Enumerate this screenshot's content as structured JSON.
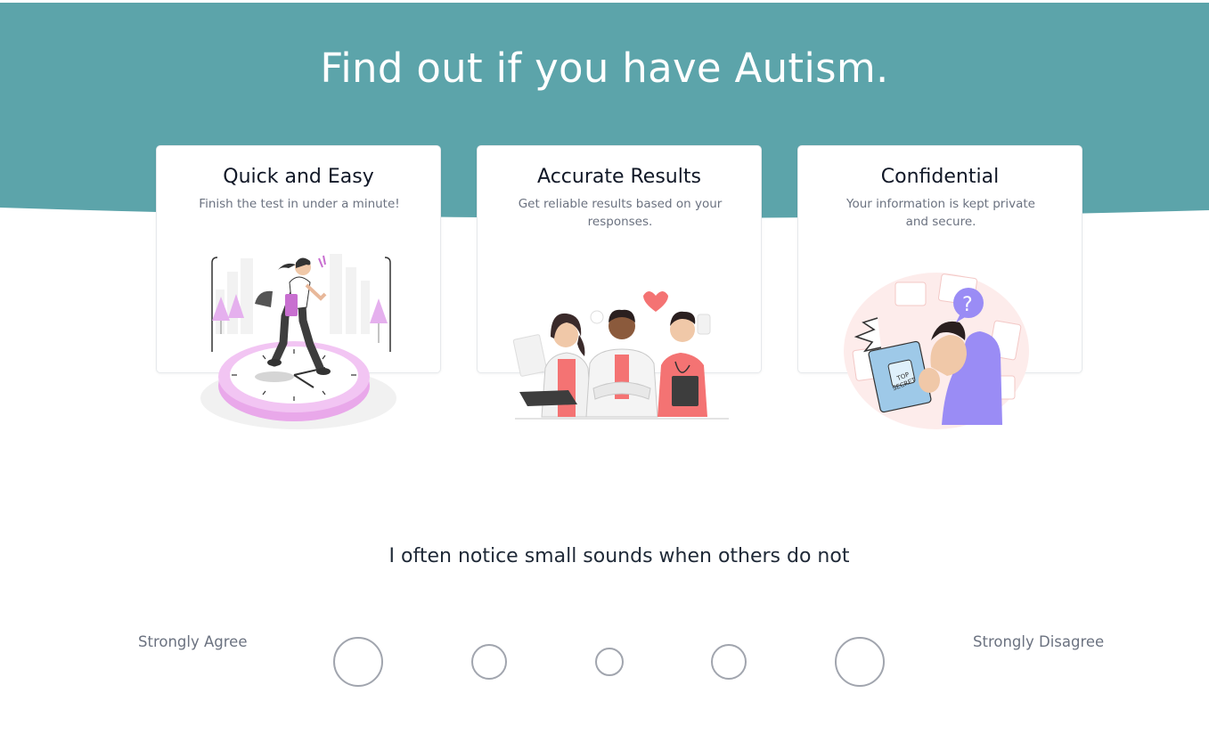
{
  "hero": {
    "title": "Find out if you have Autism.",
    "background_color": "#5ca4aa"
  },
  "features": [
    {
      "title": "Quick and Easy",
      "description": "Finish the test in under a minute!",
      "illustration": "woman-running-on-clock-illustration"
    },
    {
      "title": "Accurate Results",
      "description": "Get reliable results based on your responses.",
      "illustration": "medical-team-illustration"
    },
    {
      "title": "Confidential",
      "description": "Your information is kept private and secure.",
      "illustration": "man-holding-top-secret-folder-illustration",
      "folder_text_line1": "TOP",
      "folder_text_line2": "SECRET",
      "bubble_text": "?"
    }
  ],
  "question": {
    "text": "I often notice small sounds when others do not",
    "left_label": "Strongly Agree",
    "right_label": "Strongly Disagree",
    "options": [
      "strongly-agree",
      "agree",
      "neutral",
      "disagree",
      "strongly-disagree"
    ]
  },
  "colors": {
    "accent": "#5ca4aa",
    "illustration_pink": "#f47373",
    "illustration_lilac": "#e5b0ee",
    "illustration_purple": "#9a8cf5",
    "radio_border": "#a1a5ae"
  }
}
